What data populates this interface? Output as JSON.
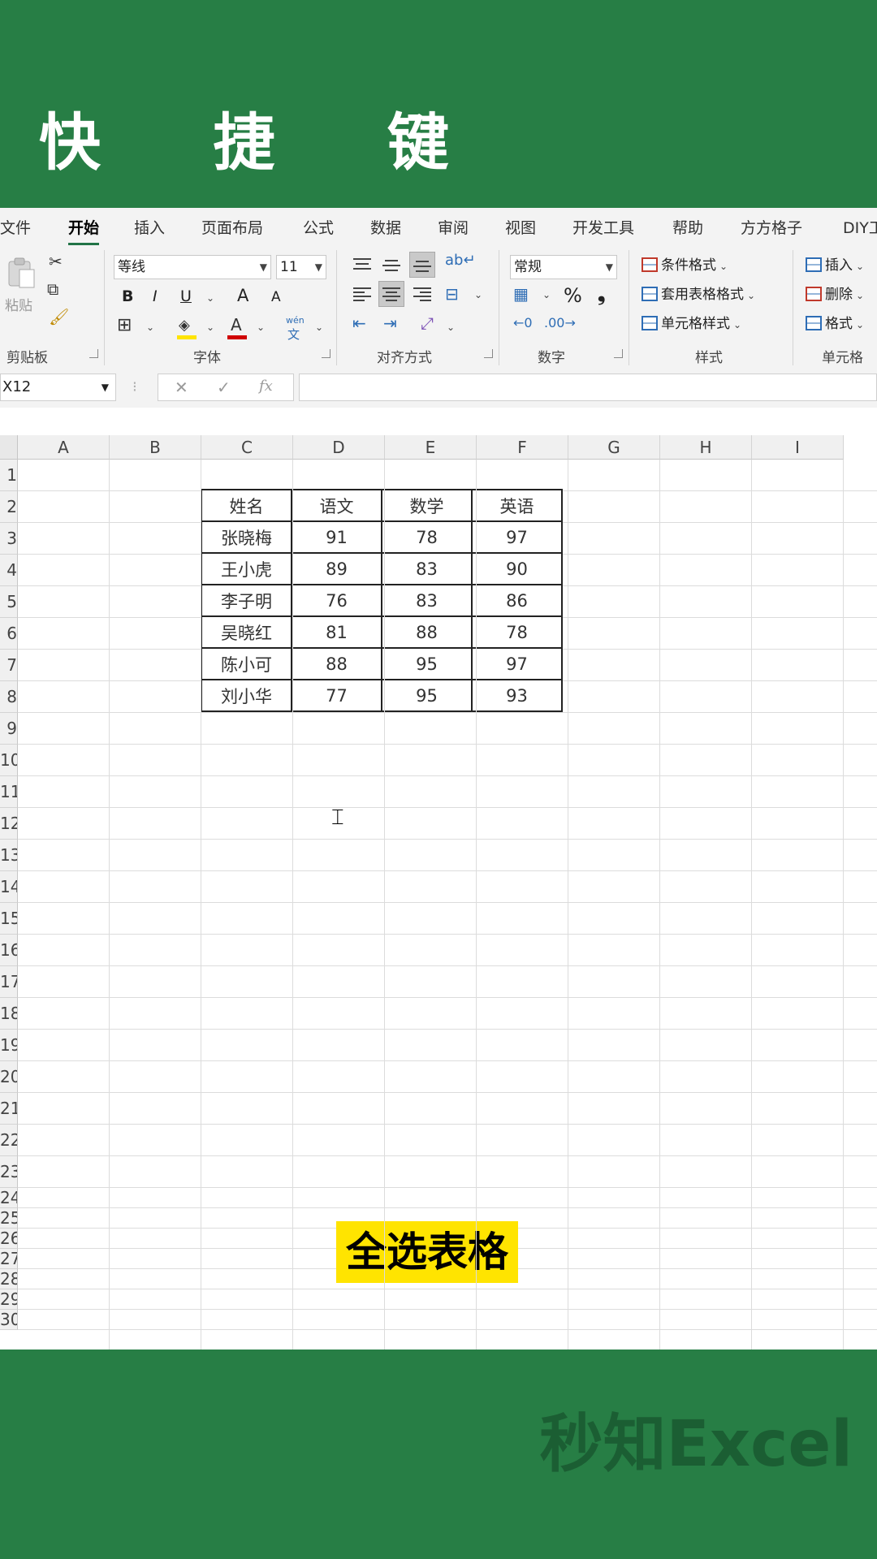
{
  "banner": {
    "title": "快 捷 键"
  },
  "ribbon": {
    "tabs": [
      "文件",
      "开始",
      "插入",
      "页面布局",
      "公式",
      "数据",
      "审阅",
      "视图",
      "开发工具",
      "帮助",
      "方方格子",
      "DIY工"
    ],
    "active_tab": "开始",
    "clipboard": {
      "paste_label": "粘贴",
      "group_label": "剪贴板"
    },
    "font": {
      "font_name": "等线",
      "font_size": "11",
      "group_label": "字体",
      "bold": "B",
      "italic": "I",
      "underline": "U",
      "grow": "A",
      "shrink": "A",
      "font_color": "A",
      "phonetic_top": "wén",
      "phonetic_bottom": "文"
    },
    "alignment": {
      "group_label": "对齐方式"
    },
    "number": {
      "format": "常规",
      "percent": "%",
      "comma": "❟",
      "group_label": "数字"
    },
    "styles": {
      "conditional": "条件格式",
      "table": "套用表格格式",
      "cell": "单元格样式",
      "group_label": "样式"
    },
    "cells": {
      "insert": "插入",
      "delete": "删除",
      "format": "格式",
      "group_label": "单元格"
    }
  },
  "formula_bar": {
    "name_box": "X12",
    "fx": "fx",
    "cancel": "✕",
    "enter": "✓",
    "formula": ""
  },
  "sheet": {
    "columns": [
      "A",
      "B",
      "C",
      "D",
      "E",
      "F",
      "G",
      "H",
      "I"
    ],
    "rows": [
      "1",
      "2",
      "3",
      "4",
      "5",
      "6",
      "7",
      "8",
      "9",
      "10",
      "11",
      "12",
      "13",
      "14",
      "15",
      "16",
      "17",
      "18",
      "19",
      "20",
      "21",
      "22",
      "23",
      "24",
      "25",
      "26",
      "27",
      "28",
      "29",
      "30"
    ],
    "table": {
      "header": [
        "姓名",
        "语文",
        "数学",
        "英语"
      ],
      "rows": [
        [
          "张晓梅",
          "91",
          "78",
          "97"
        ],
        [
          "王小虎",
          "89",
          "83",
          "90"
        ],
        [
          "李子明",
          "76",
          "83",
          "86"
        ],
        [
          "吴晓红",
          "81",
          "88",
          "78"
        ],
        [
          "陈小可",
          "88",
          "95",
          "97"
        ],
        [
          "刘小华",
          "77",
          "95",
          "93"
        ]
      ]
    }
  },
  "overlay_label": "全选表格",
  "watermark": "秒知Excel",
  "colors": {
    "brand_green": "#277e45",
    "excel_green": "#217346",
    "highlight_yellow": "#ffe400"
  }
}
